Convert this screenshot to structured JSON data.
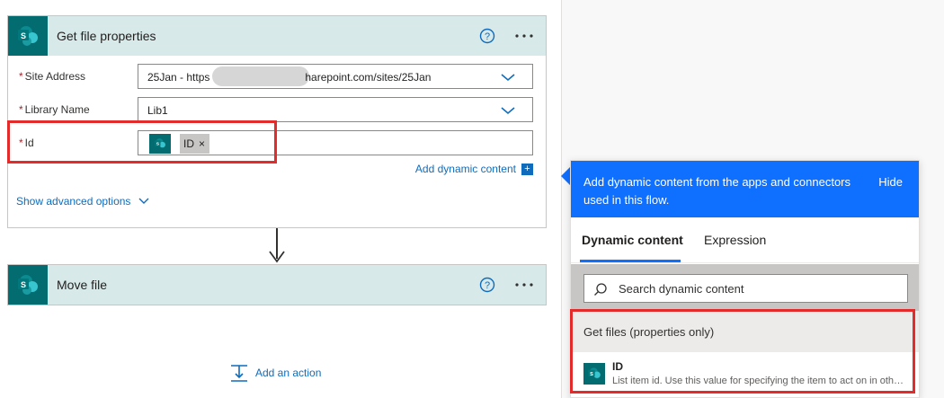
{
  "colors": {
    "accent": "#0f6fff",
    "link": "#0f6cbd",
    "sharepoint": "#036c70",
    "highlight": "#e32b2b",
    "card_header": "#d8e9e9"
  },
  "card1": {
    "title": "Get file properties",
    "help_icon": "help-circle-icon",
    "more_icon": "more-horizontal-icon",
    "fields": [
      {
        "label": "Site Address",
        "value_prefix": "25Jan - https",
        "value_suffix": "harepoint.com/sites/25Jan"
      },
      {
        "label": "Library Name",
        "value": "Lib1"
      },
      {
        "label": "Id",
        "token": {
          "label": "ID",
          "remove": "×"
        }
      }
    ],
    "required_mark": "*",
    "add_dynamic_content": "Add dynamic content",
    "plus": "+",
    "show_advanced": "Show advanced options"
  },
  "card2": {
    "title": "Move file"
  },
  "add_action": "Add an action",
  "panel": {
    "header_text": "Add dynamic content from the apps and connectors used in this flow.",
    "hide": "Hide",
    "tabs": [
      "Dynamic content",
      "Expression"
    ],
    "search_placeholder": "Search dynamic content",
    "group": "Get files (properties only)",
    "item": {
      "name": "ID",
      "description": "List item id. Use this value for specifying the item to act on in other actions."
    }
  }
}
